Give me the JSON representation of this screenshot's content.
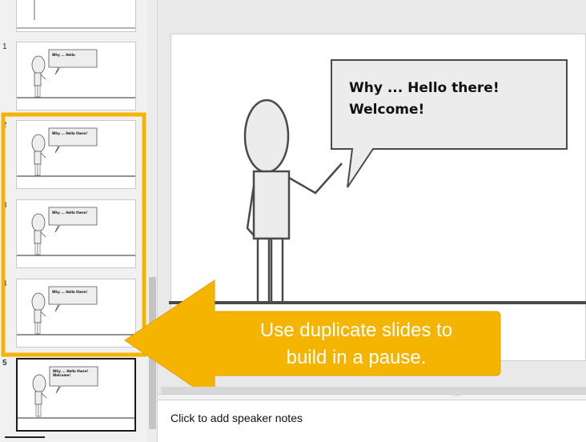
{
  "filmstrip": {
    "slides": [
      {
        "number": "1",
        "text": "Why ... Hello"
      },
      {
        "number": "2",
        "text": "Why ... Hello there!"
      },
      {
        "number": "3",
        "text": "Why ... Hello there!"
      },
      {
        "number": "4",
        "text": "Why ... Hello there!"
      },
      {
        "number": "5",
        "text": "Why ... Hello there! Welcome!"
      }
    ],
    "selected_slide": "5"
  },
  "slide": {
    "bubble_line1": "Why ... Hello there!",
    "bubble_line2": "Welcome!"
  },
  "callout": {
    "line1": "Use duplicate slides to",
    "line2": "build in a pause.",
    "color": "#f5b400"
  },
  "notes": {
    "placeholder": "Click to add speaker notes"
  }
}
